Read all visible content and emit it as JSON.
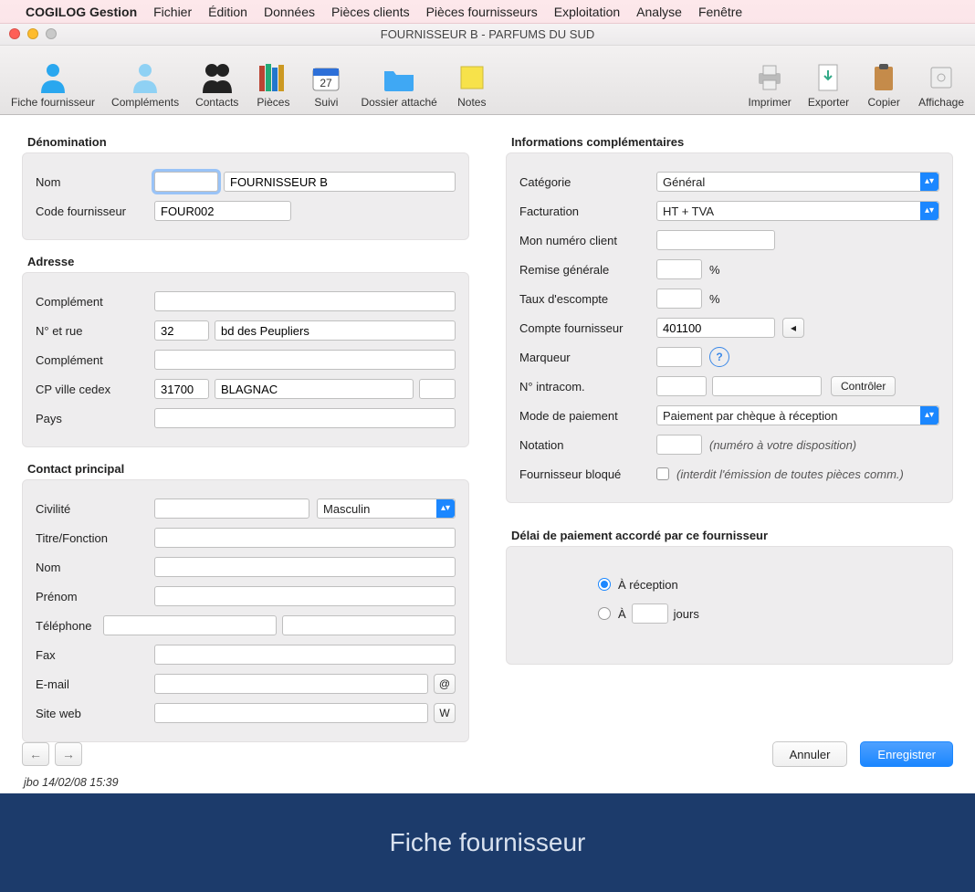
{
  "menubar": {
    "app": "COGILOG Gestion",
    "items": [
      "Fichier",
      "Édition",
      "Données",
      "Pièces clients",
      "Pièces fournisseurs",
      "Exploitation",
      "Analyse",
      "Fenêtre"
    ]
  },
  "window": {
    "title": "FOURNISSEUR B - PARFUMS DU SUD"
  },
  "toolbar": {
    "left": [
      {
        "label": "Fiche fournisseur",
        "icon": "person-blue"
      },
      {
        "label": "Compléments",
        "icon": "person-blue-light"
      },
      {
        "label": "Contacts",
        "icon": "people-black"
      },
      {
        "label": "Pièces",
        "icon": "books"
      },
      {
        "label": "Suivi",
        "icon": "calendar"
      },
      {
        "label": "Dossier attaché",
        "icon": "folder"
      },
      {
        "label": "Notes",
        "icon": "note"
      }
    ],
    "right": [
      {
        "label": "Imprimer",
        "icon": "printer"
      },
      {
        "label": "Exporter",
        "icon": "export"
      },
      {
        "label": "Copier",
        "icon": "clipboard"
      },
      {
        "label": "Affichage",
        "icon": "display"
      }
    ]
  },
  "sections": {
    "denomination": "Dénomination",
    "adresse": "Adresse",
    "contact": "Contact principal",
    "infos": "Informations complémentaires",
    "delai": "Délai de paiement accordé par ce fournisseur"
  },
  "labels": {
    "nom": "Nom",
    "code": "Code fournisseur",
    "complement": "Complément",
    "numrue": "N° et rue",
    "cp": "CP ville cedex",
    "pays": "Pays",
    "civilite": "Civilité",
    "titre": "Titre/Fonction",
    "contact_nom": "Nom",
    "prenom": "Prénom",
    "tel": "Téléphone",
    "fax": "Fax",
    "email": "E-mail",
    "web": "Site web",
    "categorie": "Catégorie",
    "facturation": "Facturation",
    "numclient": "Mon numéro client",
    "remise": "Remise générale",
    "escompte": "Taux d'escompte",
    "compte": "Compte fournisseur",
    "marqueur": "Marqueur",
    "intracom": "N° intracom.",
    "mode": "Mode de paiement",
    "notation": "Notation",
    "bloque": "Fournisseur bloqué",
    "pct": "%",
    "jours": "jours",
    "a": "À",
    "areception": "À réception",
    "controler": "Contrôler",
    "notation_hint": "(numéro à votre disposition)",
    "bloque_hint": "(interdit l'émission de toutes pièces comm.)",
    "at": "@",
    "w": "W"
  },
  "values": {
    "nom_prefix": "",
    "nom": "FOURNISSEUR B",
    "code": "FOUR002",
    "adresse_complement1": "",
    "num": "32",
    "rue": "bd des Peupliers",
    "adresse_complement2": "",
    "cp": "31700",
    "ville": "BLAGNAC",
    "cedex": "",
    "pays": "",
    "civilite": "",
    "genre": "Masculin",
    "titre": "",
    "contact_nom": "",
    "prenom": "",
    "tel1": "",
    "tel2": "",
    "fax": "",
    "email": "",
    "web": "",
    "categorie": "Général",
    "facturation": "HT + TVA",
    "numclient": "",
    "remise": "",
    "escompte": "",
    "compte": "401100",
    "marqueur": "",
    "intracom1": "",
    "intracom2": "",
    "mode": "Paiement par chèque à réception",
    "notation": "",
    "bloque": false,
    "delai_mode": "reception",
    "delai_jours": ""
  },
  "footer": {
    "annuler": "Annuler",
    "enregistrer": "Enregistrer",
    "meta": "jbo 14/02/08 15:39"
  },
  "banner": "Fiche fournisseur"
}
